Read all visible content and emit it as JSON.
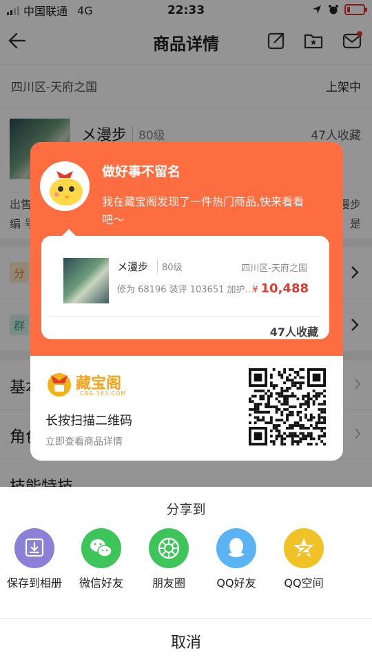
{
  "status_bar": {
    "carrier": "中国联通",
    "network": "4G",
    "time": "22:33",
    "battery_level": 0.2
  },
  "nav": {
    "title": "商品详情"
  },
  "background": {
    "region": "四川区-天府之国",
    "listing_status": "上架中",
    "seller_name": "メ漫步",
    "seller_level": "80级",
    "seller_favorites": "47人收藏",
    "desc_left_1": "出售",
    "desc_left_2": "编 号",
    "desc_right_1": "漫步",
    "desc_right_2": "是",
    "tag1": "分",
    "tag2": "群",
    "section1": "基本",
    "section2": "角色",
    "section3": "技能特技"
  },
  "card": {
    "title": "做好事不留名",
    "message": "我在藏宝阁发现了一件热门商品,快来看看吧～",
    "item": {
      "name": "メ漫步",
      "level": "80级",
      "region": "四川区-天府之国",
      "stats": "修为 68196  装评 103651  加护…",
      "currency": "¥",
      "price": "10,488",
      "favorites": "47人收藏"
    },
    "brand_name": "藏宝阁",
    "brand_domain": "CBG.163.COM",
    "scan_text": "长按扫描二维码",
    "scan_sub": "立即查看商品详情"
  },
  "share_sheet": {
    "title": "分享到",
    "options": [
      {
        "label": "保存到相册",
        "icon": "download-icon",
        "color": "#8b7fd8"
      },
      {
        "label": "微信好友",
        "icon": "wechat-icon",
        "color": "#3ec55a"
      },
      {
        "label": "朋友圈",
        "icon": "moments-icon",
        "color": "#3ec55a"
      },
      {
        "label": "QQ好友",
        "icon": "qq-icon",
        "color": "#5ab4f3"
      },
      {
        "label": "QQ空间",
        "icon": "qzone-icon",
        "color": "#f0c226"
      }
    ],
    "cancel": "取消"
  }
}
